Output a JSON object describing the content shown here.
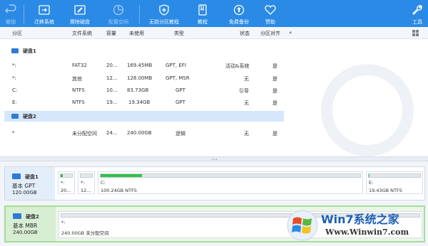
{
  "toolbar": {
    "undo": "撤销",
    "migrate": "迁移系统",
    "wipe": "擦除磁盘",
    "allocate": "配置空间",
    "lossless": "无损分区教程",
    "tutorial": "教程",
    "backup": "免费备份",
    "sponsor": "赞助",
    "tools": "工具"
  },
  "columns": {
    "partition": "分区",
    "filesystem": "文件系统",
    "capacity": "容量",
    "unused": "未使用",
    "type": "类型",
    "status": "状态",
    "aligned": "分区对齐"
  },
  "disks": [
    {
      "name": "硬盘1",
      "rows": [
        {
          "partition": "*:",
          "filesystem": "FAT32",
          "capacity": "20...",
          "unused": "169.45MB",
          "type": "GPT, EFI",
          "status": "活动&系统",
          "aligned": "是"
        },
        {
          "partition": "*:",
          "filesystem": "其他",
          "capacity": "12...",
          "unused": "128.00MB",
          "type": "GPT, MSR",
          "status": "无",
          "aligned": "是"
        },
        {
          "partition": "C:",
          "filesystem": "NTFS",
          "capacity": "10...",
          "unused": "83.73GB",
          "type": "GPT",
          "status": "引导",
          "aligned": "是"
        },
        {
          "partition": "E:",
          "filesystem": "NTFS",
          "capacity": "19...",
          "unused": "19.34GB",
          "type": "GPT",
          "status": "无",
          "aligned": "是"
        }
      ]
    },
    {
      "name": "硬盘2",
      "rows": [
        {
          "partition": "*",
          "filesystem": "未分配空间",
          "capacity": "24...",
          "unused": "240.00GB",
          "type": "逻辑",
          "status": "无",
          "aligned": "是"
        }
      ]
    }
  ],
  "map": {
    "disk1": {
      "name": "硬盘1",
      "type": "基本 GPT",
      "size": "120.00GB",
      "parts": [
        {
          "name": "*:",
          "desc": "20...",
          "used_fraction": 0.17
        },
        {
          "name": "*:",
          "desc": "12...",
          "used_fraction": 0.0
        },
        {
          "name": "C:",
          "desc": "100.24GB NTFS",
          "used_fraction": 0.16
        },
        {
          "name": "E:",
          "desc": "19.43GB NTFS",
          "used_fraction": 0.005
        }
      ]
    },
    "disk2": {
      "name": "硬盘2",
      "type": "基本 MBR",
      "size": "240.00GB",
      "parts": [
        {
          "name": "*:",
          "desc": "240.00GB 未分配空间",
          "used_fraction": 0.0
        }
      ]
    }
  },
  "watermark": {
    "title": "Win7系统之家",
    "url": "Www.Winwin7.com"
  },
  "colors": {
    "toolbar": "#2b8ae5",
    "selection": "#d6e7fb",
    "used_fill": "#2fc24a"
  }
}
